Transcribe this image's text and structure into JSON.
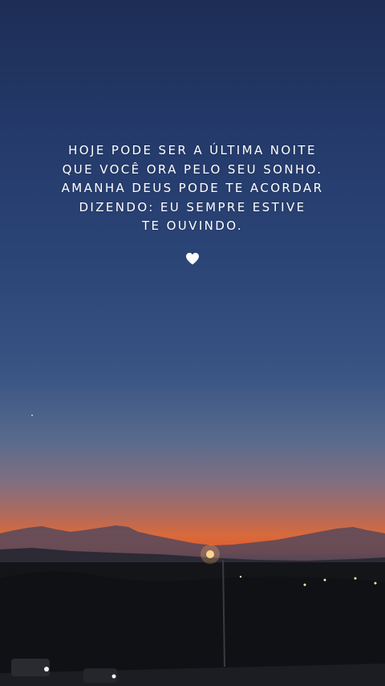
{
  "quote": {
    "lines": [
      "HOJE PODE SER A ÚLTIMA NOITE",
      "QUE VOCÊ ORA PELO SEU SONHO.",
      "AMANHA DEUS PODE TE ACORDAR",
      "DIZENDO: EU SEMPRE ESTIVE",
      "TE OUVINDO."
    ]
  },
  "icons": {
    "heart": "heart-icon"
  },
  "colors": {
    "sky_top": "#1d2d55",
    "sky_mid": "#2c4678",
    "horizon_orange": "#e0602e",
    "ground": "#17181f",
    "text": "#ffffff"
  }
}
